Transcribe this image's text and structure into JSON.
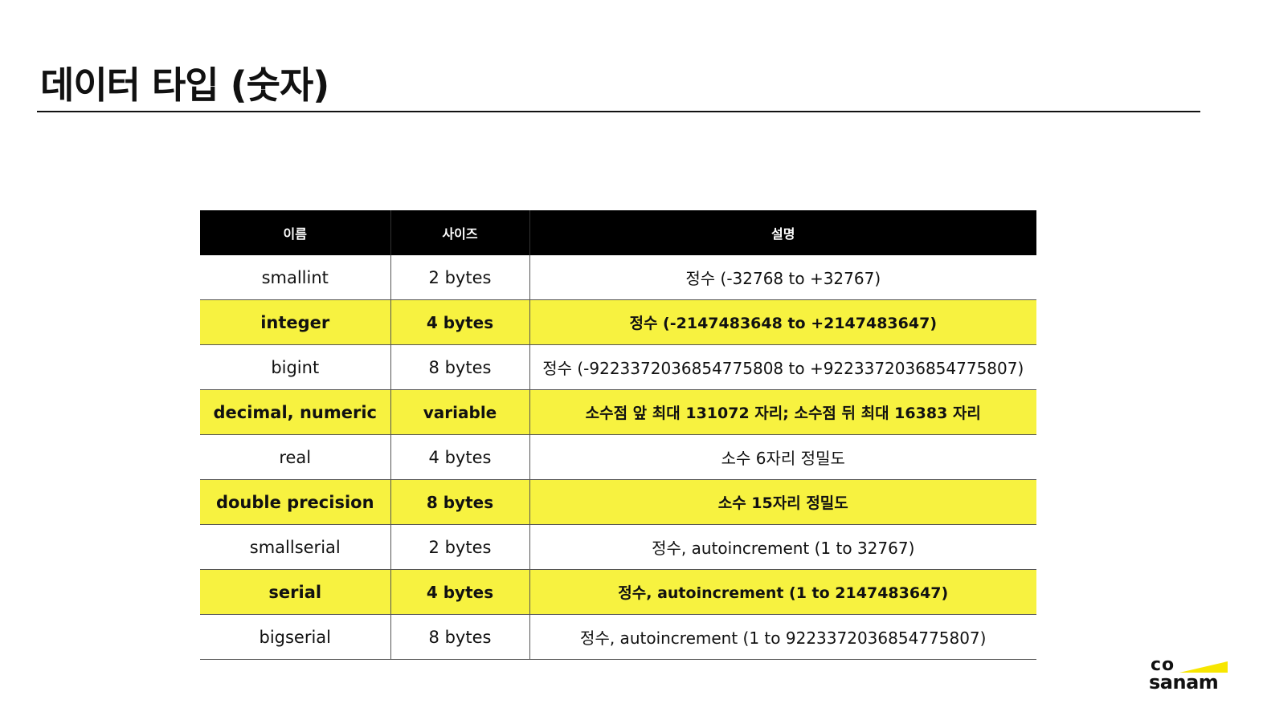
{
  "slide": {
    "title": "데이터 타입 (숫자)"
  },
  "table": {
    "headers": [
      "이름",
      "사이즈",
      "설명"
    ],
    "rows": [
      {
        "name": "smallint",
        "size": "2 bytes",
        "description": "정수 (-32768 to +32767)",
        "highlighted": false
      },
      {
        "name": "integer",
        "size": "4 bytes",
        "description": "정수 (-2147483648 to +2147483647)",
        "highlighted": true
      },
      {
        "name": "bigint",
        "size": "8 bytes",
        "description": "정수 (-9223372036854775808 to +9223372036854775807)",
        "highlighted": false
      },
      {
        "name": "decimal, numeric",
        "size": "variable",
        "description": "소수점 앞 최대 131072 자리; 소수점 뒤 최대 16383 자리",
        "highlighted": true
      },
      {
        "name": "real",
        "size": "4 bytes",
        "description": "소수 6자리 정밀도",
        "highlighted": false
      },
      {
        "name": "double precision",
        "size": "8 bytes",
        "description": "소수 15자리 정밀도",
        "highlighted": true
      },
      {
        "name": "smallserial",
        "size": "2 bytes",
        "description": "정수, autoincrement (1 to 32767)",
        "highlighted": false
      },
      {
        "name": "serial",
        "size": "4 bytes",
        "description": "정수, autoincrement (1 to 2147483647)",
        "highlighted": true
      },
      {
        "name": "bigserial",
        "size": "8 bytes",
        "description": "정수, autoincrement (1 to 9223372036854775807)",
        "highlighted": false
      }
    ]
  },
  "logo": {
    "line1": "co",
    "line2": "sanam",
    "accent_color": "#f7e600"
  },
  "colors": {
    "highlight_row": "#f7f240",
    "header_bg": "#000000"
  }
}
